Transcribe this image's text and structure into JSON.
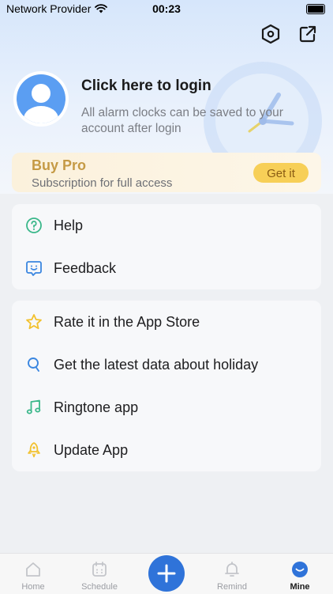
{
  "status_bar": {
    "carrier": "Network Provider",
    "time": "00:23"
  },
  "profile": {
    "login_title": "Click here to login",
    "login_subtitle": "All alarm clocks can be saved to your account after login"
  },
  "pro_banner": {
    "title": "Buy Pro",
    "subtitle": "Subscription for full access",
    "button_label": "Get it"
  },
  "menu_group_1": [
    {
      "label": "Help",
      "icon": "help-icon"
    },
    {
      "label": "Feedback",
      "icon": "feedback-icon"
    }
  ],
  "menu_group_2": [
    {
      "label": "Rate it in the App Store",
      "icon": "star-icon"
    },
    {
      "label": "Get the latest data about holiday",
      "icon": "search-icon"
    },
    {
      "label": "Ringtone app",
      "icon": "music-icon"
    },
    {
      "label": "Update App",
      "icon": "rocket-icon"
    }
  ],
  "tabs": [
    {
      "label": "Home",
      "icon": "home-icon"
    },
    {
      "label": "Schedule",
      "icon": "calendar-icon"
    },
    {
      "label": "",
      "icon": "plus-icon"
    },
    {
      "label": "Remind",
      "icon": "bell-icon"
    },
    {
      "label": "Mine",
      "icon": "smile-icon",
      "active": true
    }
  ],
  "colors": {
    "accent": "#2f73d9",
    "pro_gold": "#c59a45",
    "pro_button": "#f7cf57",
    "icon_green": "#3ab78a",
    "icon_yellow": "#f2c12e",
    "icon_blue": "#3a86e0"
  }
}
